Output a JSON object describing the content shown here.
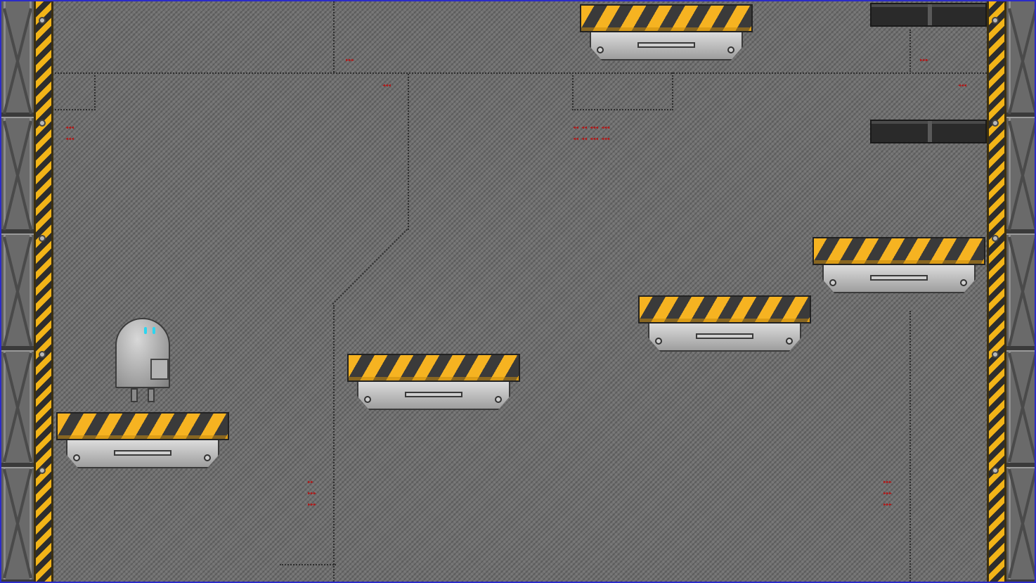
{
  "game": {
    "title": "",
    "player": {
      "name": "robot",
      "eye_color": "#2bd6f0"
    },
    "platforms": [
      {
        "id": "platform-start"
      },
      {
        "id": "platform-middle"
      },
      {
        "id": "platform-step-1"
      },
      {
        "id": "platform-step-2"
      },
      {
        "id": "platform-top"
      }
    ],
    "palette": {
      "hazard_yellow": "#f6b321",
      "hazard_dark": "#3a3a3a",
      "floor_grey": "#707070",
      "arrow_red": "#b01818",
      "frame_blue": "#2b2bc8"
    }
  }
}
